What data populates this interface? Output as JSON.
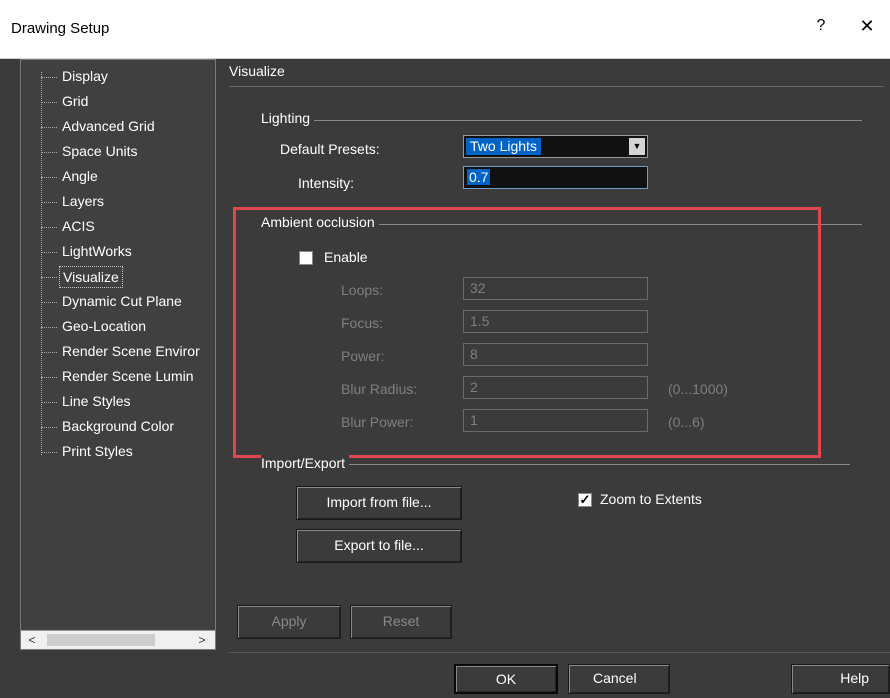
{
  "window": {
    "title": "Drawing Setup",
    "help": "?",
    "close": "✕"
  },
  "tree": {
    "items": [
      {
        "label": "Display"
      },
      {
        "label": "Grid"
      },
      {
        "label": "Advanced Grid"
      },
      {
        "label": "Space Units"
      },
      {
        "label": "Angle"
      },
      {
        "label": "Layers"
      },
      {
        "label": "ACIS"
      },
      {
        "label": "LightWorks"
      },
      {
        "label": "Visualize",
        "selected": true
      },
      {
        "label": "Dynamic Cut Plane"
      },
      {
        "label": "Geo-Location"
      },
      {
        "label": "Render Scene Enviror"
      },
      {
        "label": "Render Scene Lumin"
      },
      {
        "label": "Line Styles"
      },
      {
        "label": "Background Color"
      },
      {
        "label": "Print Styles"
      }
    ],
    "scroll_left": "<",
    "scroll_right": ">"
  },
  "panel": {
    "title": "Visualize",
    "lighting": {
      "group": "Lighting",
      "presets_label": "Default Presets:",
      "presets_value": "Two Lights",
      "intensity_label": "Intensity:",
      "intensity_value": "0.7"
    },
    "ambient": {
      "group": "Ambient occlusion",
      "enable_label": "Enable",
      "enabled": false,
      "fields": [
        {
          "label": "Loops:",
          "value": "32",
          "range": ""
        },
        {
          "label": "Focus:",
          "value": "1.5",
          "range": ""
        },
        {
          "label": "Power:",
          "value": "8",
          "range": ""
        },
        {
          "label": "Blur Radius:",
          "value": "2",
          "range": "(0...1000)"
        },
        {
          "label": "Blur Power:",
          "value": "1",
          "range": "(0...6)"
        }
      ]
    },
    "io": {
      "group": "Import/Export",
      "import_label": "Import from file...",
      "export_label": "Export to file...",
      "zoom_label": "Zoom to Extents",
      "zoom_checked": true
    },
    "apply_label": "Apply",
    "reset_label": "Reset"
  },
  "footer": {
    "ok": "OK",
    "cancel": "Cancel",
    "help": "Help"
  },
  "colors": {
    "background": "#3b3b3b",
    "selection": "#0063c6",
    "highlight": "#e0474c"
  }
}
